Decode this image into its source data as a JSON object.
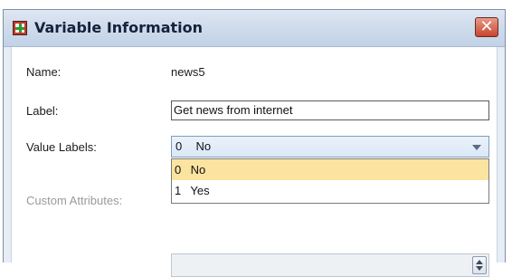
{
  "dialog": {
    "title": "Variable Information",
    "close_glyph": "✕",
    "icon": "spss-data-icon"
  },
  "fields": {
    "name_label": "Name:",
    "name_value": "news5",
    "label_label": "Label:",
    "label_value": "Get news from internet",
    "value_labels_label": "Value Labels:",
    "value_labels_selected_code": "0",
    "value_labels_selected_text": "No",
    "custom_attributes_label": "Custom Attributes:"
  },
  "dropdown": {
    "options": [
      {
        "code": "0",
        "text": "No"
      },
      {
        "code": "1",
        "text": "Yes"
      }
    ],
    "selected_index": 0
  },
  "colors": {
    "selected_option_bg": "#fbe3a0",
    "close_button": "#c8452f"
  }
}
